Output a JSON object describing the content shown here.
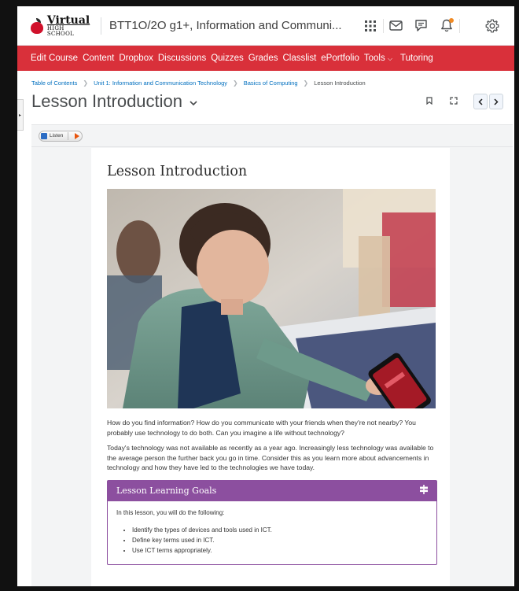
{
  "logo": {
    "line1": "Virtual",
    "line2": "HIGH SCHOOL"
  },
  "header": {
    "course_title": "BTT1O/2O g1+, Information and Communi...",
    "icons": [
      "apps-grid-icon",
      "mail-icon",
      "chat-icon",
      "bell-icon",
      "gear-icon"
    ]
  },
  "nav": {
    "items": [
      "Edit Course",
      "Content",
      "Dropbox",
      "Discussions",
      "Quizzes",
      "Grades",
      "Classlist",
      "ePortfolio",
      "Tools",
      "Tutoring"
    ],
    "accent": "#d9303a"
  },
  "breadcrumb": {
    "items": [
      "Table of Contents",
      "Unit 1: Information and Communication Technology",
      "Basics of Computing"
    ],
    "current": "Lesson Introduction"
  },
  "page": {
    "title": "Lesson Introduction"
  },
  "listen": {
    "label": "Listen"
  },
  "content": {
    "heading": "Lesson Introduction",
    "paragraph1": "How do you find information? How do you communicate with your friends when they're not nearby? You probably use technology to do both. Can you imagine a life without technology?",
    "paragraph2": "Today's technology was not available as recently as a year ago. Increasingly less technology was available to the average person the further back you go in time. Consider this as you learn more about advancements in technology and how they have led to the technologies we have today.",
    "goals": {
      "title": "Lesson Learning Goals",
      "intro": "In this lesson, you will do the following:",
      "items": [
        "Identify the types of devices and tools used in ICT.",
        "Define key terms used in ICT.",
        "Use ICT terms appropriately."
      ],
      "color": "#8c4f9f"
    }
  }
}
